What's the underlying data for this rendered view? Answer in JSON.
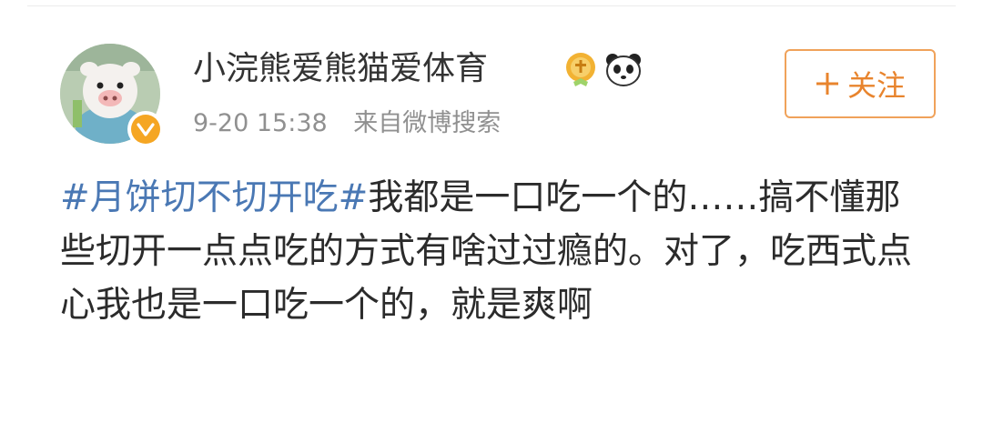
{
  "user": {
    "name": "小浣熊爱熊猫爱体育",
    "avatar_icon": "piglet-mascot-avatar",
    "verified_icon": "verified-badge-icon",
    "badges": [
      "membership-badge-icon",
      "panda-badge-icon"
    ]
  },
  "meta": {
    "time": "9-20 15:38",
    "source": "来自微博搜索"
  },
  "follow_button": {
    "label": "关注",
    "icon": "plus-icon"
  },
  "post": {
    "hashtag": "#月饼切不切开吃#",
    "text": "我都是一口吃一个的……搞不懂那些切开一点点吃的方式有啥过过瘾的。对了，吃西式点心我也是一口吃一个的，就是爽啊"
  },
  "colors": {
    "hashtag": "#4a78b4",
    "follow_accent": "#e8842d",
    "verified": "#f5a623",
    "meta_text": "#909090"
  }
}
